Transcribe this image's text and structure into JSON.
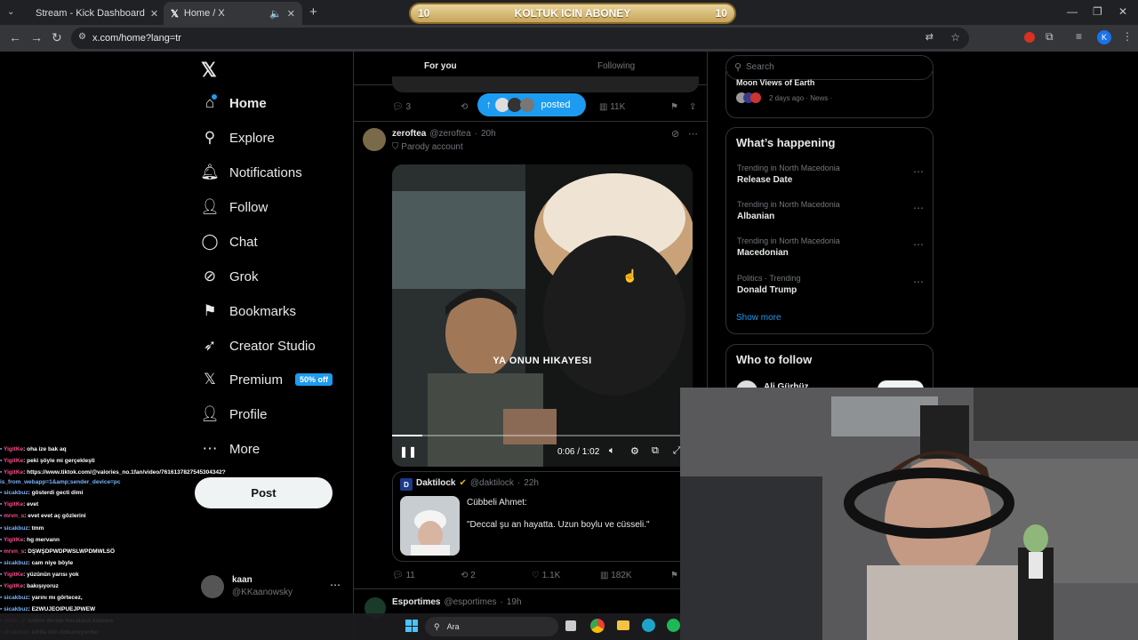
{
  "browser": {
    "tabs": [
      {
        "title": "Stream - Kick Dashboard"
      },
      {
        "title": "Home / X"
      }
    ],
    "address": "x.com/home?lang=tr",
    "banner": {
      "left": "10",
      "text": "KOLTUK ICIN ABONEY",
      "right": "10"
    }
  },
  "sidebar": {
    "items": [
      {
        "label": "Home",
        "icon": "home-icon"
      },
      {
        "label": "Explore",
        "icon": "search-icon"
      },
      {
        "label": "Notifications",
        "icon": "bell-icon"
      },
      {
        "label": "Follow",
        "icon": "follow-icon"
      },
      {
        "label": "Chat",
        "icon": "chat-icon"
      },
      {
        "label": "Grok",
        "icon": "grok-icon"
      },
      {
        "label": "Bookmarks",
        "icon": "bookmark-icon"
      },
      {
        "label": "Creator Studio",
        "icon": "rocket-icon"
      },
      {
        "label": "Premium",
        "icon": "x-logo-icon",
        "badge": "50% off"
      },
      {
        "label": "Profile",
        "icon": "person-icon"
      },
      {
        "label": "More",
        "icon": "more-circle-icon"
      }
    ],
    "post_label": "Post",
    "account": {
      "name": "kaan",
      "handle": "@KKaanowsky"
    }
  },
  "feed": {
    "tabs": [
      "For you",
      "Following"
    ],
    "posted_pill": "posted",
    "prev_actions": {
      "replies": "3",
      "views": "11K"
    },
    "tweet": {
      "name": "zeroftea",
      "handle": "@zeroftea",
      "time": "20h",
      "label": "Parody account",
      "video_caption": "YA ONUN HIKAYESI",
      "video_time": "0:06 / 1:02",
      "quote": {
        "name": "Daktilock",
        "handle": "@daktilock",
        "time": "22h",
        "line1": "Cübbeli Ahmet:",
        "line2": "\"Deccal şu an hayatta. Uzun boylu ve cüsseli.\""
      },
      "actions": {
        "replies": "11",
        "retweets": "2",
        "likes": "1.1K",
        "views": "182K"
      }
    },
    "next": {
      "name": "Esportimes",
      "handle": "@esportimes",
      "time": "19h"
    }
  },
  "right": {
    "search_placeholder": "Search",
    "news": {
      "title": "Moon Views of Earth",
      "meta": "2 days ago · News ·"
    },
    "happening_title": "What’s happening",
    "trends": [
      {
        "context": "Trending in North Macedonia",
        "name": "Release Date"
      },
      {
        "context": "Trending in North Macedonia",
        "name": "Albanian"
      },
      {
        "context": "Trending in North Macedonia",
        "name": "Macedonian"
      },
      {
        "context": "Politics · Trending",
        "name": "Donald Trump"
      }
    ],
    "show_more": "Show more",
    "who_to_follow": "Who to follow",
    "follow_name": "Ali Gürbüz"
  },
  "chat": [
    {
      "user": "YigitKe",
      "msg": ": oha ize bak aq"
    },
    {
      "user": "YigitKe",
      "msg": ": peki şöyle mi gerçekleşti"
    },
    {
      "user": "YigitKe",
      "msg": ": https://www.tiktok.com/@valories_no.1fan/video/7616137827545304342?"
    },
    {
      "user": "",
      "msg": "is_from_webapp=1&amp;sender_device=pc"
    },
    {
      "user": "sicakbuz",
      "msg": ": gösterdi gecti dimi"
    },
    {
      "user": "YigitKe",
      "msg": ": evet"
    },
    {
      "user": "mrvn_s",
      "msg": ": evet evet aç gözlerini"
    },
    {
      "user": "sicakbuz",
      "msg": ": tmm"
    },
    {
      "user": "YigitKe",
      "msg": ": hg mervann"
    },
    {
      "user": "mrvn_s",
      "msg": ": DŞWŞDPWDPWSLWPDMWLSÖ"
    },
    {
      "user": "sicakbuz",
      "msg": ": cam niye böyle"
    },
    {
      "user": "YigitKe",
      "msg": ": yüzünün yarısı yok"
    },
    {
      "user": "YigitKe",
      "msg": ": bakışıyoruz"
    },
    {
      "user": "sicakbuz",
      "msg": ": yarını mı görtecez,"
    },
    {
      "user": "sicakbuz",
      "msg": ": E2WUJEOIPUEJPWEW"
    },
    {
      "user": "mrvn_s",
      "msg": ": online derste hocaların kamera"
    },
    {
      "user": "sicakbuz",
      "msg": ": kilitle elin dokunuyordur"
    }
  ],
  "taskbar": {
    "search": "Ara"
  },
  "colors": {
    "accent": "#1d9bf0",
    "pink": "#ff4b8b"
  }
}
